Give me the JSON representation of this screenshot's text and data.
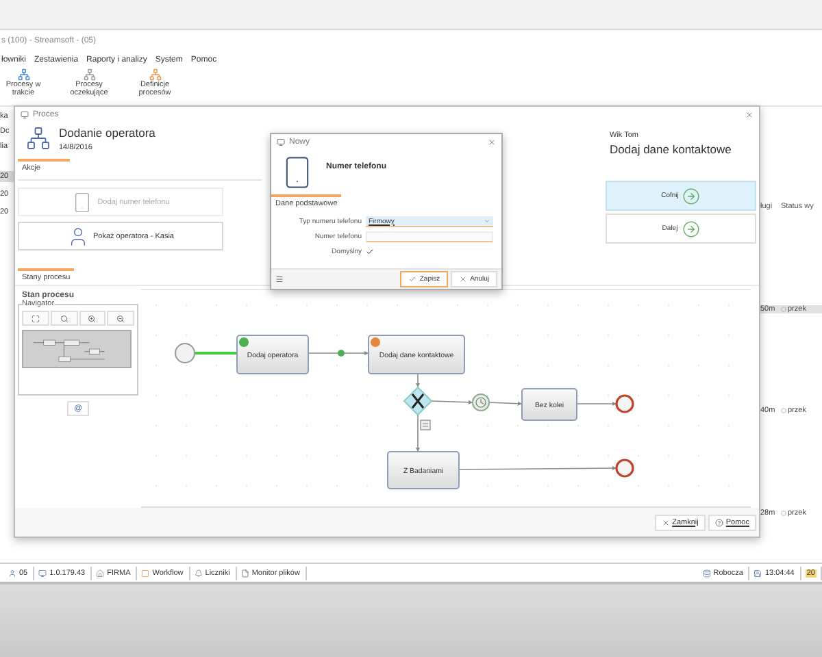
{
  "background_app": {
    "title": "s (100) - Streamsoft - (05)",
    "menu": [
      "łowniki",
      "Zestawienia",
      "Raporty i analizy",
      "System",
      "Pomoc"
    ],
    "ribbon": [
      {
        "label": "Procesy w trakcie"
      },
      {
        "label": "Procesy oczekujące"
      },
      {
        "label": "Definicje procesów"
      }
    ],
    "left_fragments": [
      "ka",
      "Dc",
      "lia"
    ],
    "left_rows": [
      {
        "text": "20",
        "selected": true
      },
      {
        "text": "20",
        "selected": false
      },
      {
        "text": "20",
        "selected": false
      }
    ],
    "table": {
      "columns": [
        "ługi",
        "Status wy"
      ],
      "rows": [
        {
          "cells": [
            "50m",
            "przek"
          ],
          "selected": true
        },
        {
          "cells": [
            "40m",
            "przek"
          ],
          "selected": false
        },
        {
          "cells": [
            "28m",
            "przek"
          ],
          "selected": false
        }
      ]
    }
  },
  "process_window": {
    "title": "Proces",
    "process_name": "Dodanie operatora",
    "date": "14/8/2016",
    "user": "Wik Tom",
    "step": "Dodaj dane kontaktowe",
    "tabs": [
      {
        "label": "Akcje",
        "selected": true
      }
    ],
    "actions": [
      {
        "label": "Dodaj numer telefonu",
        "kind": "phone",
        "disabled": true
      },
      {
        "label": "Pokaż operatora - Kasia",
        "kind": "person",
        "disabled": false
      }
    ],
    "step_buttons": [
      {
        "label": "Cofnij",
        "selected": true
      },
      {
        "label": "Dalej",
        "selected": false
      }
    ],
    "state_tabs": [
      {
        "label": "Stany procesu",
        "selected": true
      }
    ],
    "state_title": "Stan procesu",
    "navigator": {
      "title": "Navigator",
      "at_button": "@"
    },
    "diagram": {
      "nodes": [
        {
          "kind": "start"
        },
        {
          "kind": "task",
          "label": "Dodaj operatora",
          "color": "#4caf50"
        },
        {
          "kind": "task",
          "label": "Dodaj dane kontaktowe",
          "color": "#e8873a"
        },
        {
          "kind": "gateway"
        },
        {
          "kind": "timer"
        },
        {
          "kind": "task",
          "label": "Bez kolei"
        },
        {
          "kind": "end"
        },
        {
          "kind": "task",
          "label": "Z Badaniami"
        },
        {
          "kind": "end"
        }
      ]
    },
    "footer_buttons": [
      {
        "label": "Zamknij",
        "kind": "close"
      },
      {
        "label": "Pomoc",
        "kind": "help"
      }
    ]
  },
  "dialog": {
    "title": "Nowy",
    "heading": "Numer telefonu",
    "tab": {
      "label": "Dane podstawowe",
      "selected": true
    },
    "fields": [
      {
        "kind": "select",
        "label": "Typ numeru telefonu",
        "value": "Firmowy"
      },
      {
        "kind": "input",
        "label": "Numer telefonu"
      },
      {
        "kind": "checkbox",
        "label": "Domyślny",
        "checked": true
      }
    ],
    "buttons": [
      {
        "label": "Zapisz",
        "kind": "save",
        "focused": true
      },
      {
        "label": "Anuluj",
        "kind": "cancel",
        "focused": false
      }
    ]
  },
  "status_bar": {
    "left": [
      {
        "kind": "user",
        "text": "05"
      },
      {
        "kind": "version",
        "text": "1.0.179.43"
      },
      {
        "kind": "company",
        "text": "FIRMA"
      },
      {
        "kind": "workflow",
        "text": "Workflow"
      },
      {
        "kind": "counter",
        "text": "Liczniki"
      },
      {
        "kind": "files",
        "text": "Monitor plików"
      }
    ],
    "right": [
      {
        "kind": "database",
        "text": "Robocza"
      },
      {
        "kind": "time",
        "text": "13:04:44"
      },
      {
        "kind": "year",
        "text": "20"
      }
    ]
  }
}
